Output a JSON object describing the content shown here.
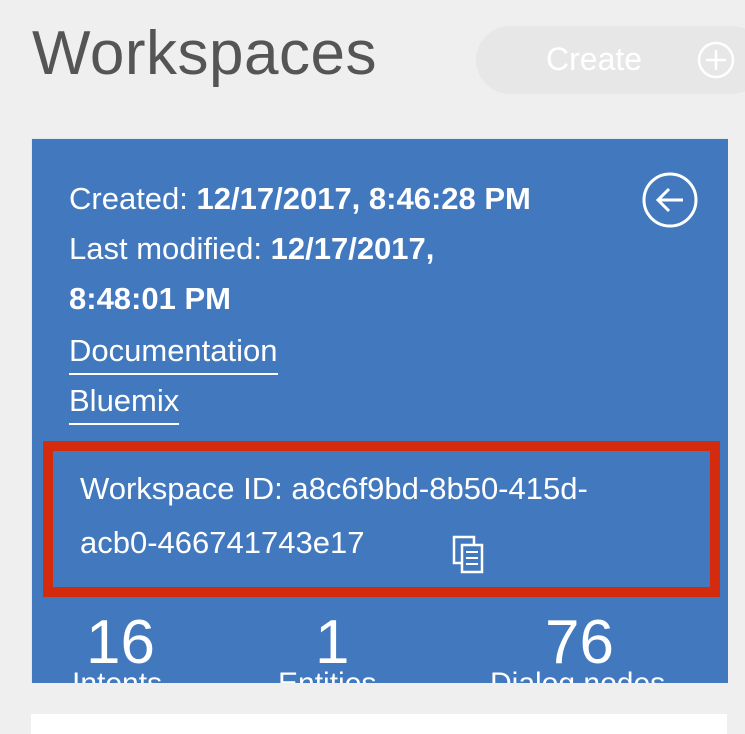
{
  "header": {
    "title": "Workspaces",
    "create_label": "Create"
  },
  "workspace_card": {
    "created_label": "Created:",
    "created_value": "12/17/2017, 8:46:28 PM",
    "modified_label": "Last modified:",
    "modified_value_line1": "12/17/2017,",
    "modified_value_line2": "8:48:01 PM",
    "links": [
      "Documentation",
      "Bluemix"
    ],
    "workspace_id_label": "Workspace ID:",
    "workspace_id_line1": "a8c6f9bd-8b50-415d-",
    "workspace_id_line2": "acb0-466741743e17",
    "stats": [
      {
        "value": "16",
        "label": "Intents"
      },
      {
        "value": "1",
        "label": "Entities"
      },
      {
        "value": "76",
        "label": "Dialog nodes"
      }
    ]
  },
  "colors": {
    "card_bg": "#4178be",
    "highlight_border": "#d42a0d",
    "page_bg": "#efefef"
  },
  "icons": {
    "create": "plus-circle-icon",
    "back": "arrow-left-circle-icon",
    "copy": "copy-icon"
  }
}
